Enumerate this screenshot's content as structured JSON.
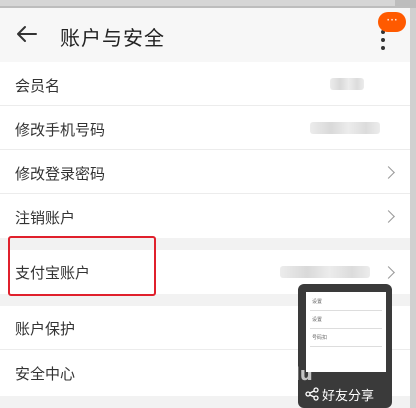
{
  "header": {
    "title": "账户与安全",
    "badge": "···"
  },
  "rows": [
    {
      "label": "会员名"
    },
    {
      "label": "修改手机号码"
    },
    {
      "label": "修改登录密码"
    },
    {
      "label": "注销账户"
    },
    {
      "label": "支付宝账户"
    },
    {
      "label": "账户保护"
    },
    {
      "label": "安全中心"
    }
  ],
  "share": {
    "label": "好友分享",
    "mini_lines": [
      "设置",
      "设置",
      "号码扣"
    ]
  },
  "watermark": "Baidu",
  "colors": {
    "highlight": "#e0202c",
    "badge": "#ff5a00"
  }
}
